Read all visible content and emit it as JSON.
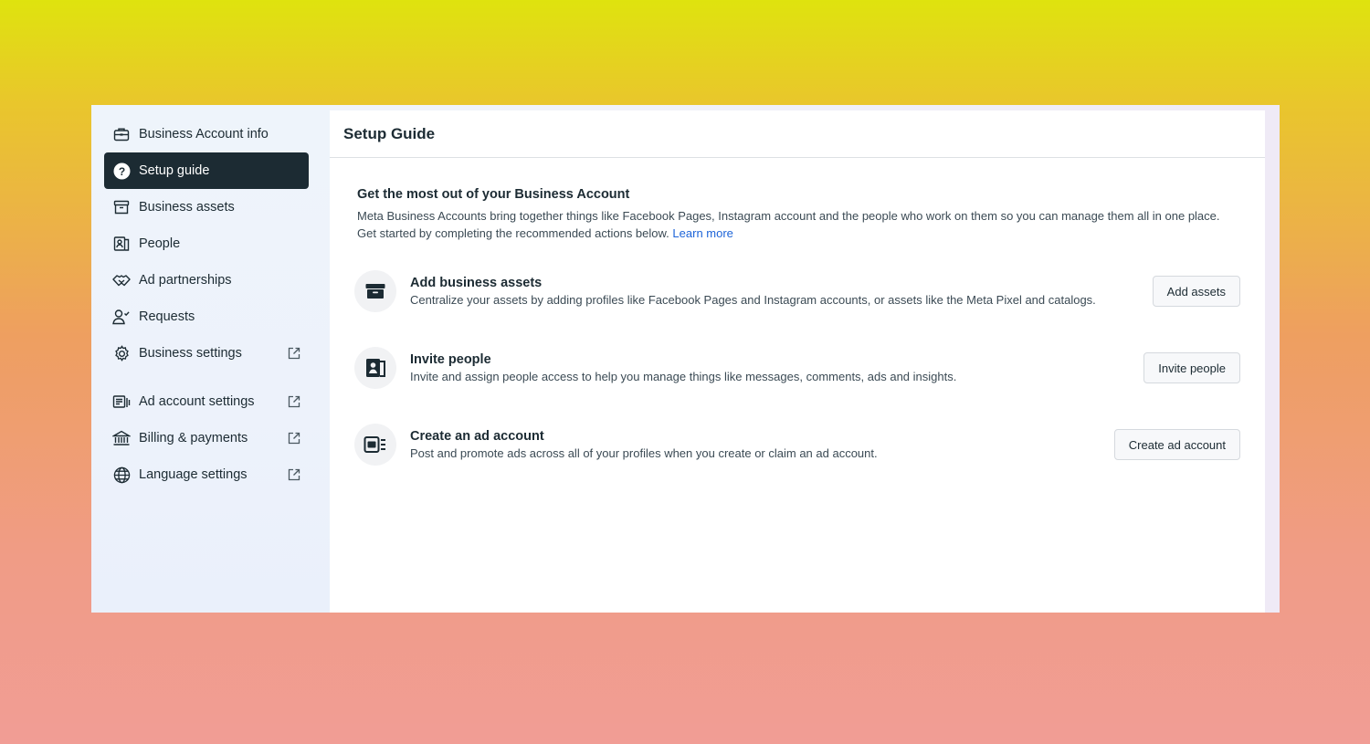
{
  "sidebar": {
    "items": [
      {
        "label": "Business Account info",
        "icon": "briefcase-icon"
      },
      {
        "label": "Setup guide",
        "icon": "question-circle-icon",
        "active": true
      },
      {
        "label": "Business assets",
        "icon": "archive-box-icon"
      },
      {
        "label": "People",
        "icon": "id-badge-icon"
      },
      {
        "label": "Ad partnerships",
        "icon": "handshake-icon"
      },
      {
        "label": "Requests",
        "icon": "person-check-icon"
      },
      {
        "label": "Business settings",
        "icon": "gear-icon",
        "external": true
      },
      {
        "label": "Ad account settings",
        "icon": "ad-account-icon",
        "external": true
      },
      {
        "label": "Billing & payments",
        "icon": "bank-icon",
        "external": true
      },
      {
        "label": "Language settings",
        "icon": "globe-icon",
        "external": true
      }
    ]
  },
  "main": {
    "title": "Setup Guide",
    "intro": {
      "title": "Get the most out of your Business Account",
      "desc": "Meta Business Accounts bring together things like Facebook Pages, Instagram account and the people who work on them so you can manage them all in one place. Get started by completing the recommended actions below.",
      "link": "Learn more"
    },
    "tasks": [
      {
        "title": "Add business assets",
        "desc": "Centralize your assets by adding profiles like Facebook Pages and Instagram accounts, or assets like the Meta Pixel and catalogs.",
        "button": "Add assets",
        "icon": "archive-box-icon"
      },
      {
        "title": "Invite people",
        "desc": "Invite and assign people access to help you manage things like messages, comments, ads and insights.",
        "button": "Invite people",
        "icon": "id-badge-icon"
      },
      {
        "title": "Create an ad account",
        "desc": "Post and promote ads across all of your profiles when you create or claim an ad account.",
        "button": "Create ad account",
        "icon": "ad-account-icon"
      }
    ]
  },
  "colors": {
    "sidebar_active_bg": "#1c2b33",
    "link": "#1d64d8",
    "text": "#1c2b33"
  }
}
